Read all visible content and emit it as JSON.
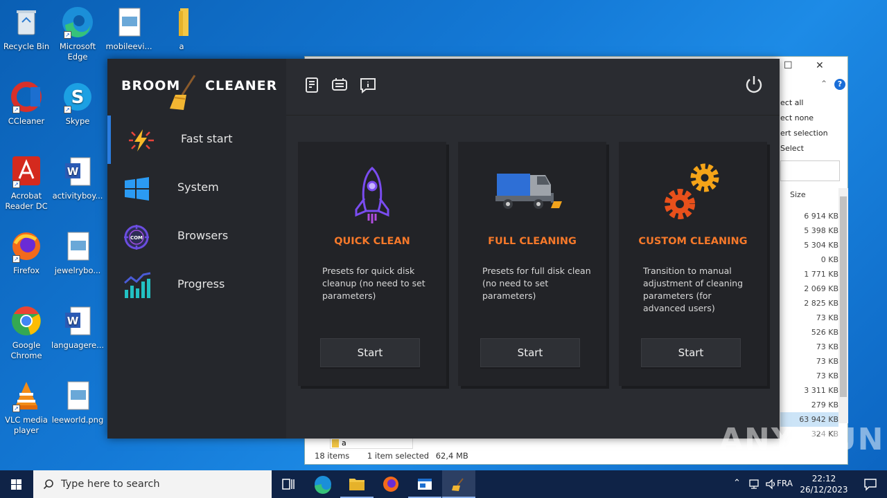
{
  "desktop": {
    "icons": [
      {
        "label": "Recycle Bin"
      },
      {
        "label": "Microsoft Edge"
      },
      {
        "label": "mobileevi..."
      },
      {
        "label": "a"
      },
      {
        "label": "CCleaner"
      },
      {
        "label": "Skype"
      },
      {
        "label": "Acrobat Reader DC"
      },
      {
        "label": "activityboy..."
      },
      {
        "label": "Firefox"
      },
      {
        "label": "jewelrybo..."
      },
      {
        "label": "Google Chrome"
      },
      {
        "label": "languagere..."
      },
      {
        "label": "VLC media player"
      },
      {
        "label": "leeworld.png"
      }
    ]
  },
  "explorer": {
    "select_menu": [
      "ect all",
      "ect none",
      "ert selection",
      "Select"
    ],
    "size_header": "Size",
    "sizes": [
      "6 914 KB",
      "5 398 KB",
      "5 304 KB",
      "0 KB",
      "1 771 KB",
      "2 069 KB",
      "2 825 KB",
      "73 KB",
      "526 KB",
      "73 KB",
      "73 KB",
      "73 KB",
      "3 311 KB",
      "279 KB",
      "63 942 KB",
      "324 KB"
    ],
    "address_folder": "a",
    "status": {
      "items": "18 items",
      "selected": "1 item selected",
      "size": "62,4 MB"
    }
  },
  "app": {
    "logo_left": "BROOM",
    "logo_right": "CLEANER",
    "nav": [
      {
        "label": "Fast start"
      },
      {
        "label": "System"
      },
      {
        "label": "Browsers"
      },
      {
        "label": "Progress"
      }
    ],
    "cards": [
      {
        "title": "QUICK CLEAN",
        "desc": "Presets for quick disk cleanup (no need to set parameters)",
        "button": "Start"
      },
      {
        "title": "FULL CLEANING",
        "desc": "Presets for full disk clean (no need to set parameters)",
        "button": "Start"
      },
      {
        "title": "CUSTOM CLEANING",
        "desc": "Transition to manual adjustment of cleaning parameters (for advanced users)",
        "button": "Start"
      }
    ],
    "accent_color": "#f7792a",
    "active_color": "#2b7de0"
  },
  "taskbar": {
    "search_placeholder": "Type here to search",
    "language": "FRA",
    "time": "22:12",
    "date": "26/12/2023"
  },
  "watermark": "ANY RUN"
}
